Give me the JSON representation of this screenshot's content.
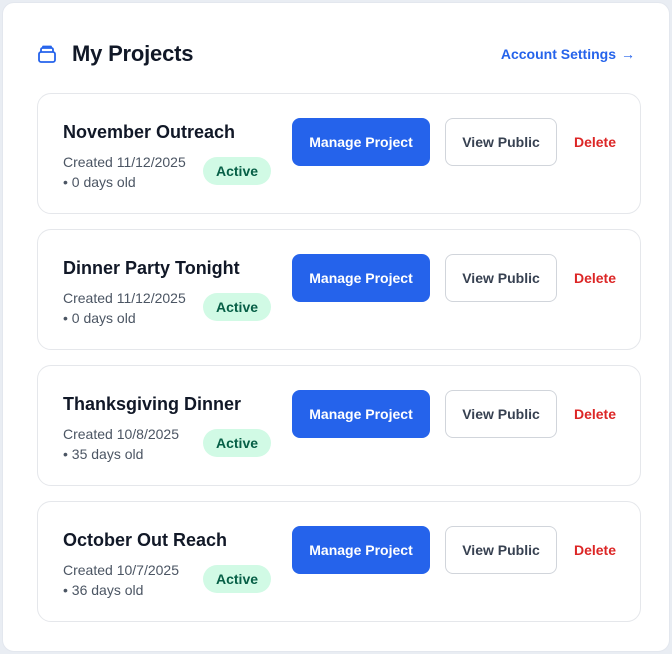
{
  "header": {
    "title": "My Projects",
    "icon": "archive-box-icon",
    "settings_label": "Account Settings",
    "settings_arrow": "→"
  },
  "colors": {
    "accent": "#2563eb",
    "active_badge_bg": "#d1fae5",
    "active_badge_text": "#065f46",
    "delete": "#dc2626"
  },
  "projects": [
    {
      "name": "November Outreach",
      "created": "Created 11/12/2025",
      "age": "• 0 days old",
      "status": "Active",
      "manage_label": "Manage Project",
      "view_label": "View Public",
      "delete_label": "Delete"
    },
    {
      "name": "Dinner Party Tonight",
      "created": "Created 11/12/2025",
      "age": "• 0 days old",
      "status": "Active",
      "manage_label": "Manage Project",
      "view_label": "View Public",
      "delete_label": "Delete"
    },
    {
      "name": "Thanksgiving Dinner",
      "created": "Created 10/8/2025",
      "age": "• 35 days old",
      "status": "Active",
      "manage_label": "Manage Project",
      "view_label": "View Public",
      "delete_label": "Delete"
    },
    {
      "name": "October Out Reach",
      "created": "Created 10/7/2025",
      "age": "• 36 days old",
      "status": "Active",
      "manage_label": "Manage Project",
      "view_label": "View Public",
      "delete_label": "Delete"
    }
  ]
}
